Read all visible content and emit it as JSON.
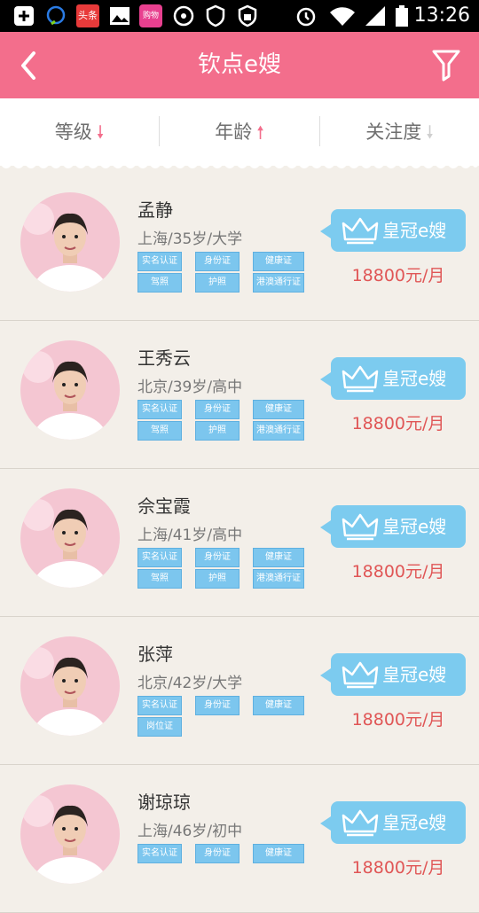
{
  "status_bar": {
    "time": "13:26",
    "notification_icons": [
      "add-icon",
      "chat-icon",
      "toutiao-app-icon",
      "image-icon",
      "shopping-app-icon",
      "podcast-icon",
      "shield-icon",
      "shield-lock-icon"
    ],
    "system_icons": [
      "alarm-icon",
      "wifi-icon",
      "signal-icon",
      "battery-icon"
    ],
    "toutiao_label": "头条",
    "shop_label": "购物街"
  },
  "header": {
    "title": "钦点e嫂",
    "back_icon": "chevron-left-icon",
    "filter_icon": "filter-icon"
  },
  "sort_bar": [
    {
      "label": "等级",
      "direction": "down",
      "arrow": "🠗",
      "color": "#f36e8c"
    },
    {
      "label": "年龄",
      "direction": "up",
      "arrow": "🠕",
      "color": "#f36e8c"
    },
    {
      "label": "关注度",
      "direction": "down",
      "arrow": "🠗",
      "color": "#cfcfcf"
    }
  ],
  "colors": {
    "accent": "#f36e8c",
    "badge": "#7ccbef",
    "price": "#e05656",
    "tag": "#7cc6ee"
  },
  "caregivers": [
    {
      "name": "孟静",
      "info": "上海/35岁/大学",
      "tags": [
        "实名认证",
        "身份证",
        "健康证",
        "驾照",
        "护照",
        "港澳通行证"
      ],
      "badge": "皇冠e嫂",
      "price": "18800元/月"
    },
    {
      "name": "王秀云",
      "info": "北京/39岁/高中",
      "tags": [
        "实名认证",
        "身份证",
        "健康证",
        "驾照",
        "护照",
        "港澳通行证"
      ],
      "badge": "皇冠e嫂",
      "price": "18800元/月"
    },
    {
      "name": "佘宝霞",
      "info": "上海/41岁/高中",
      "tags": [
        "实名认证",
        "身份证",
        "健康证",
        "驾照",
        "护照",
        "港澳通行证"
      ],
      "badge": "皇冠e嫂",
      "price": "18800元/月"
    },
    {
      "name": "张萍",
      "info": "北京/42岁/大学",
      "tags": [
        "实名认证",
        "身份证",
        "健康证",
        "岗位证"
      ],
      "badge": "皇冠e嫂",
      "price": "18800元/月"
    },
    {
      "name": "谢琼琼",
      "info": "上海/46岁/初中",
      "tags": [
        "实名认证",
        "身份证",
        "健康证"
      ],
      "badge": "皇冠e嫂",
      "price": "18800元/月"
    }
  ]
}
